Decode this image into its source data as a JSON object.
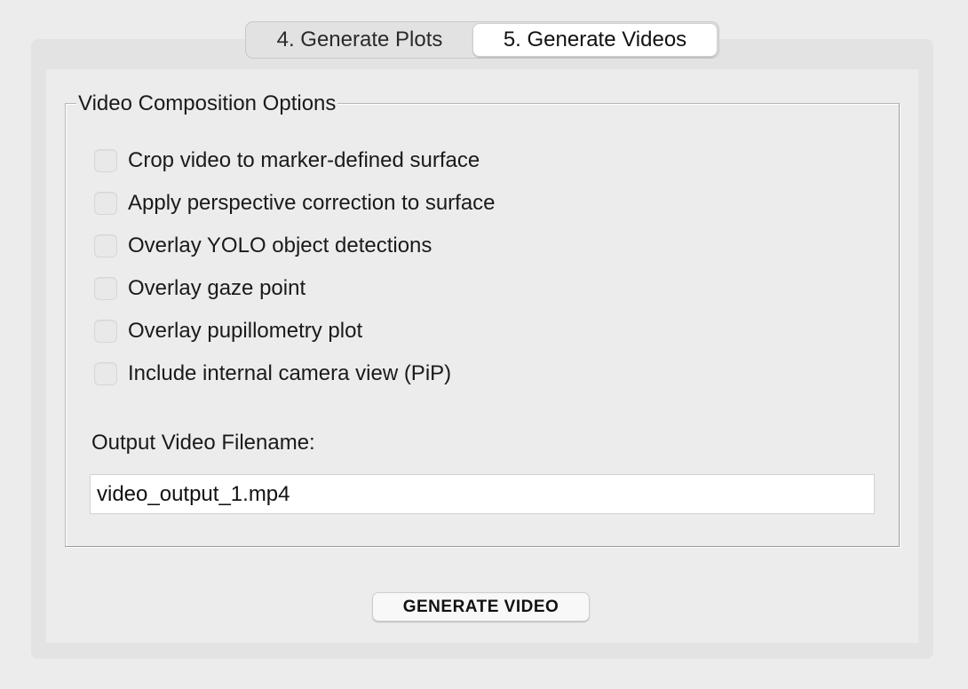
{
  "tabs": [
    {
      "label": "4. Generate Plots",
      "selected": false
    },
    {
      "label": "5. Generate Videos",
      "selected": true
    }
  ],
  "group": {
    "title": "Video Composition Options",
    "options": [
      {
        "label": "Crop video to marker-defined surface",
        "checked": false
      },
      {
        "label": "Apply perspective correction to surface",
        "checked": false
      },
      {
        "label": "Overlay YOLO object detections",
        "checked": false
      },
      {
        "label": "Overlay gaze point",
        "checked": false
      },
      {
        "label": "Overlay pupillometry plot",
        "checked": false
      },
      {
        "label": "Include internal camera view (PiP)",
        "checked": false
      }
    ],
    "filename_label": "Output Video Filename:",
    "filename_value": "video_output_1.mp4"
  },
  "button": {
    "label": "GENERATE VIDEO"
  }
}
